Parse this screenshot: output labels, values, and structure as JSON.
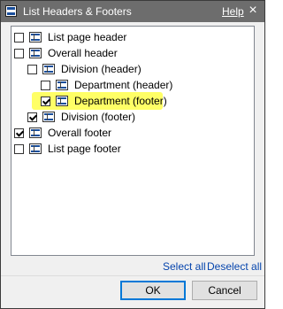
{
  "window": {
    "title": "List Headers & Footers",
    "help_label": "Help",
    "close_glyph": "×",
    "icon": "table-icon"
  },
  "tree": {
    "items": [
      {
        "label": "List page header",
        "checked": false,
        "level": 0,
        "icon": "table-icon"
      },
      {
        "label": "Overall header",
        "checked": false,
        "level": 0,
        "icon": "table-icon"
      },
      {
        "label": "Division (header)",
        "checked": false,
        "level": 1,
        "icon": "table-icon"
      },
      {
        "label": "Department (header)",
        "checked": false,
        "level": 2,
        "icon": "table-icon"
      },
      {
        "label": "Department (footer)",
        "checked": true,
        "level": 2,
        "icon": "table-icon",
        "highlighted": true
      },
      {
        "label": "Division (footer)",
        "checked": true,
        "level": 1,
        "icon": "table-icon"
      },
      {
        "label": "Overall footer",
        "checked": true,
        "level": 0,
        "icon": "table-icon"
      },
      {
        "label": "List page footer",
        "checked": false,
        "level": 0,
        "icon": "table-icon"
      }
    ]
  },
  "links": {
    "select_all": "Select all",
    "deselect_all": "Deselect all"
  },
  "buttons": {
    "ok": "OK",
    "cancel": "Cancel"
  },
  "colors": {
    "highlight": "#ffff66",
    "titlebar": "#6d6d6d",
    "link": "#0645ad",
    "icon_bar": "#1a4f9c"
  }
}
